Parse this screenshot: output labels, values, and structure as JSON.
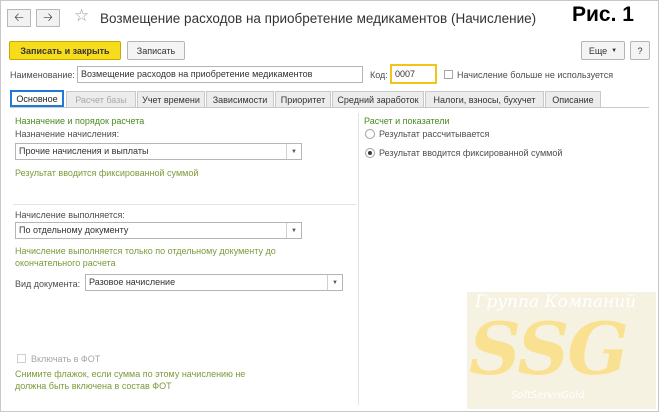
{
  "header": {
    "title": "Возмещение расходов на приобретение медикаментов (Начисление)",
    "figure_label": "Рис. 1",
    "back_icon": "arrow-left-icon",
    "forward_icon": "arrow-right-icon",
    "favorite_icon": "star-icon"
  },
  "toolbar": {
    "save_close_label": "Записать и закрыть",
    "save_label": "Записать",
    "more_label": "Еще",
    "help_label": "?"
  },
  "fields": {
    "name_label": "Наименование:",
    "name_value": "Возмещение расходов на приобретение медикаментов",
    "code_label": "Код:",
    "code_value": "0007",
    "unused_label": "Начисление больше не используется"
  },
  "tabs": [
    {
      "label": "Основное"
    },
    {
      "label": "Расчет базы"
    },
    {
      "label": "Учет времени"
    },
    {
      "label": "Зависимости"
    },
    {
      "label": "Приоритет"
    },
    {
      "label": "Средний заработок"
    },
    {
      "label": "Налоги, взносы, бухучет"
    },
    {
      "label": "Описание"
    }
  ],
  "left": {
    "section_title": "Назначение и порядок расчета",
    "purpose_label": "Назначение начисления:",
    "purpose_value": "Прочие начисления и выплаты",
    "purpose_note": "Результат вводится фиксированной суммой",
    "performed_label": "Начисление выполняется:",
    "performed_value": "По отдельному документу",
    "performed_note": "Начисление выполняется только по отдельному документу до окончательного расчета",
    "doc_kind_label": "Вид документа:",
    "doc_kind_value": "Разовое начисление",
    "fot_label": "Включать в ФОТ",
    "fot_note": "Снимите флажок, если сумма по этому начислению не должна быть включена в состав ФОТ"
  },
  "right": {
    "section_title": "Расчет и показатели",
    "option_calculated": "Результат рассчитывается",
    "option_fixed": "Результат вводится фиксированной суммой",
    "selected": "fixed"
  },
  "watermark": {
    "company_line": "Группа Компаний",
    "logo_text": "SSG",
    "sub_line": "SoftServisGold"
  },
  "colors": {
    "primary_button": "#f7dc1c",
    "active_tab_border": "#1e7ad6",
    "section_title": "#4a8a1f",
    "note_text": "#7c9a3a",
    "code_field_border": "#f0c419"
  }
}
